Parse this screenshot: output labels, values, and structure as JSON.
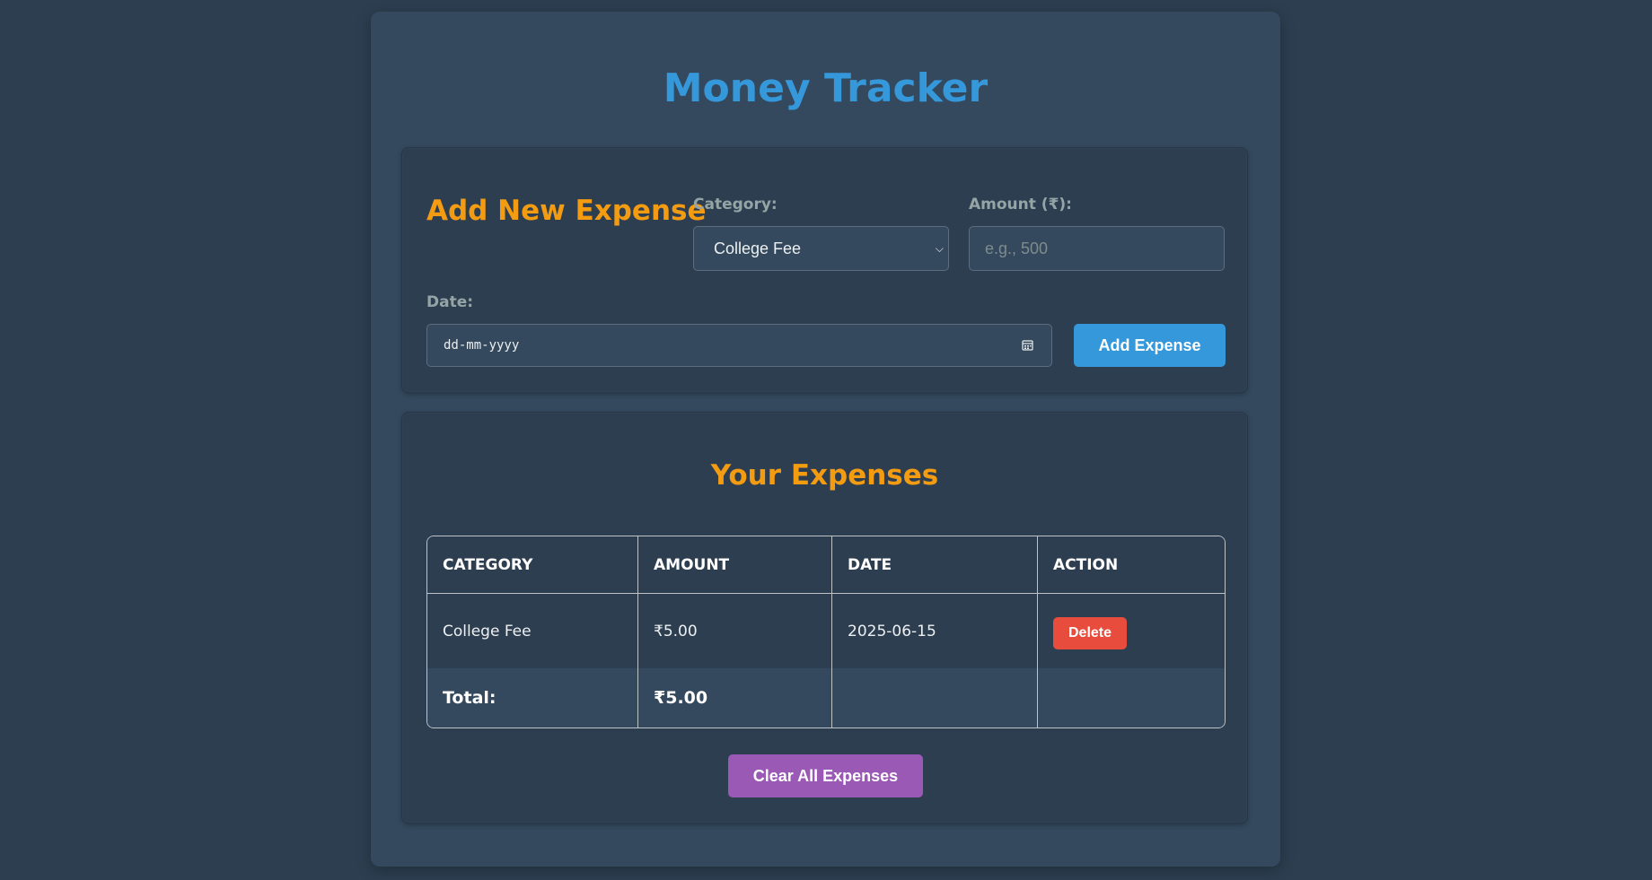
{
  "app": {
    "title": "Money Tracker"
  },
  "form": {
    "title": "Add New Expense",
    "category_label": "Category:",
    "category_value": "College Fee",
    "amount_label": "Amount (₹):",
    "amount_placeholder": "e.g., 500",
    "date_label": "Date:",
    "date_placeholder": "dd-mm-yyyy",
    "add_button": "Add Expense"
  },
  "expenses": {
    "title": "Your Expenses",
    "columns": [
      "CATEGORY",
      "AMOUNT",
      "DATE",
      "ACTION"
    ],
    "rows": [
      {
        "category": "College Fee",
        "amount": "₹5.00",
        "date": "2025-06-15",
        "action": "Delete"
      }
    ],
    "total_label": "Total:",
    "total_value": "₹5.00",
    "clear_button": "Clear All Expenses"
  },
  "icons": {
    "select_arrow": "chevron-down-icon",
    "date_picker": "calendar-icon"
  },
  "colors": {
    "page_bg": "#2c3e50",
    "card_bg": "#34495e",
    "title": "#3498db",
    "section_title": "#f39c12",
    "add_button": "#3498db",
    "delete_button": "#e74c3c",
    "clear_button": "#9b59b6"
  }
}
